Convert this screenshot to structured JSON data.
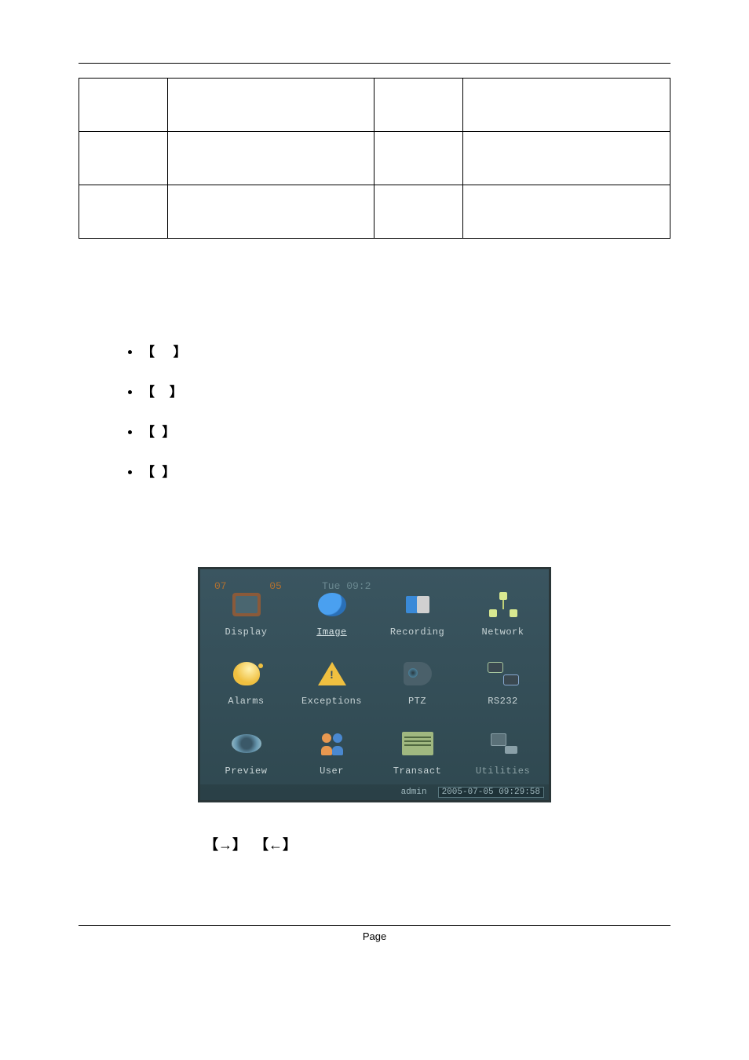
{
  "table_rows": 3,
  "bullets": [
    {
      "open": "【",
      "close": "】"
    },
    {
      "open": "【",
      "close": "】"
    },
    {
      "open": "【",
      "close": "】"
    },
    {
      "open": "【",
      "close": "】"
    }
  ],
  "menu": {
    "top_left_text": "07",
    "top_left_text2": "05",
    "top_mid_text": "Tue  09:2",
    "items": [
      {
        "label": "Display",
        "icon": "display"
      },
      {
        "label": "Image",
        "icon": "image",
        "selected": true
      },
      {
        "label": "Recording",
        "icon": "recording"
      },
      {
        "label": "Network",
        "icon": "network"
      },
      {
        "label": "Alarms",
        "icon": "alarms"
      },
      {
        "label": "Exceptions",
        "icon": "exceptions"
      },
      {
        "label": "PTZ",
        "icon": "ptz"
      },
      {
        "label": "RS232",
        "icon": "rs232"
      },
      {
        "label": "Preview",
        "icon": "preview"
      },
      {
        "label": "User",
        "icon": "user"
      },
      {
        "label": "Transact",
        "icon": "transact"
      },
      {
        "label": "Utilities",
        "icon": "utilities",
        "dim": true
      }
    ],
    "status_user": "admin",
    "status_time": "2005-07-05 09:29:58"
  },
  "arrows": {
    "b1o": "【",
    "a1": "→",
    "b1c": "】",
    "b2o": "【",
    "a2": "←",
    "b2c": "】"
  },
  "footer": "Page"
}
